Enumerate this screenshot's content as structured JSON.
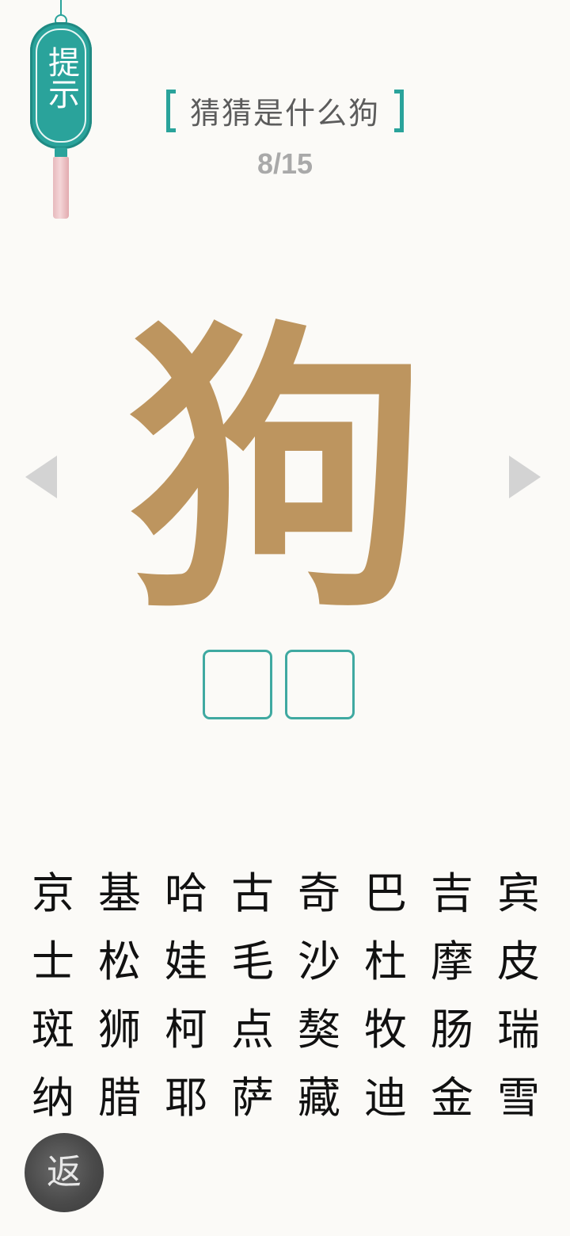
{
  "hint": {
    "label": "提示"
  },
  "puzzle": {
    "title": "猜猜是什么狗",
    "progress": "8/15",
    "main_character": "狗",
    "answer_slots": [
      "",
      ""
    ]
  },
  "character_grid": [
    [
      "京",
      "基",
      "哈",
      "古",
      "奇",
      "巴",
      "吉",
      "宾"
    ],
    [
      "士",
      "松",
      "娃",
      "毛",
      "沙",
      "杜",
      "摩",
      "皮"
    ],
    [
      "斑",
      "狮",
      "柯",
      "点",
      "獒",
      "牧",
      "肠",
      "瑞"
    ],
    [
      "纳",
      "腊",
      "耶",
      "萨",
      "藏",
      "迪",
      "金",
      "雪"
    ]
  ],
  "back_button": {
    "label": "返"
  },
  "colors": {
    "accent": "#2aa39b",
    "character": "#bd955f",
    "tassel": "#e7b9bd",
    "background": "#fbfaf7"
  },
  "icons": {
    "prev": "triangle-left-icon",
    "next": "triangle-right-icon"
  }
}
